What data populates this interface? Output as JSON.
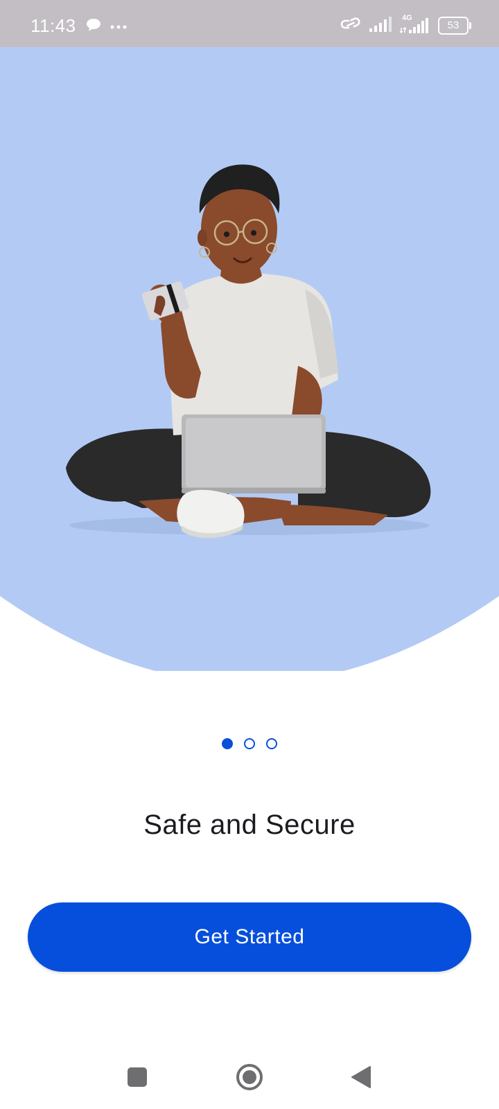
{
  "status_bar": {
    "time": "11:43",
    "network_type": "4G",
    "battery_level": "53"
  },
  "hero": {
    "background_color": "#b3cbf4"
  },
  "pager": {
    "page_count": 3,
    "current_page": 1
  },
  "onboarding": {
    "title": "Safe and Secure"
  },
  "cta": {
    "label": "Get Started",
    "color": "#064fdc"
  },
  "nav_bar": {
    "buttons": [
      "recents-button",
      "home-button",
      "back-button"
    ]
  }
}
